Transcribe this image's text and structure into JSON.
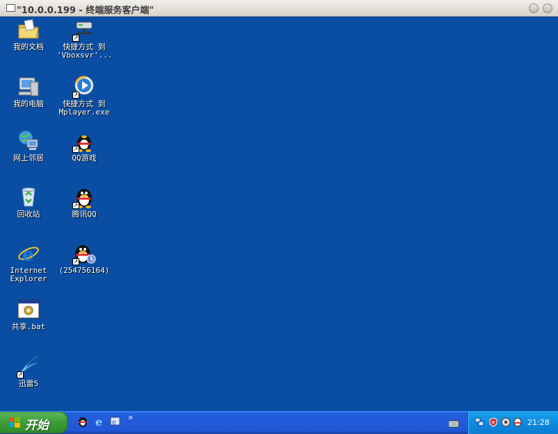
{
  "window": {
    "title": "\"10.0.0.199 - 终端服务客户端\""
  },
  "desktop_icons": [
    {
      "label": "我的文档",
      "icon": "my-documents-icon"
    },
    {
      "label": "快捷方式 到\n'Vboxsvr'...",
      "icon": "network-drive-shortcut-icon"
    },
    {
      "label": "我的电脑",
      "icon": "my-computer-icon"
    },
    {
      "label": "快捷方式 到\nMplayer.exe",
      "icon": "media-player-shortcut-icon"
    },
    {
      "label": "网上邻居",
      "icon": "network-places-icon"
    },
    {
      "label": "QQ游戏",
      "icon": "qq-game-icon"
    },
    {
      "label": "回收站",
      "icon": "recycle-bin-icon"
    },
    {
      "label": "腾讯QQ",
      "icon": "qq-penguin-icon"
    },
    {
      "label": "Internet\nExplorer",
      "icon": "internet-explorer-icon"
    },
    {
      "label": "(254756164)",
      "icon": "qq-account-icon"
    },
    {
      "label": "共享.bat",
      "icon": "batch-file-icon"
    },
    {
      "label": "迅雷5",
      "icon": "thunder-icon"
    }
  ],
  "taskbar": {
    "start_label": "开始",
    "quick_launch": [
      "qq-game-icon",
      "internet-explorer-icon",
      "show-desktop-icon"
    ],
    "chevron": "»",
    "clock": "21:28"
  },
  "colors": {
    "desktop": "#0a4ea3",
    "taskbar": "#2157d6",
    "tray": "#0f8be0",
    "start": "#3c9a39"
  }
}
